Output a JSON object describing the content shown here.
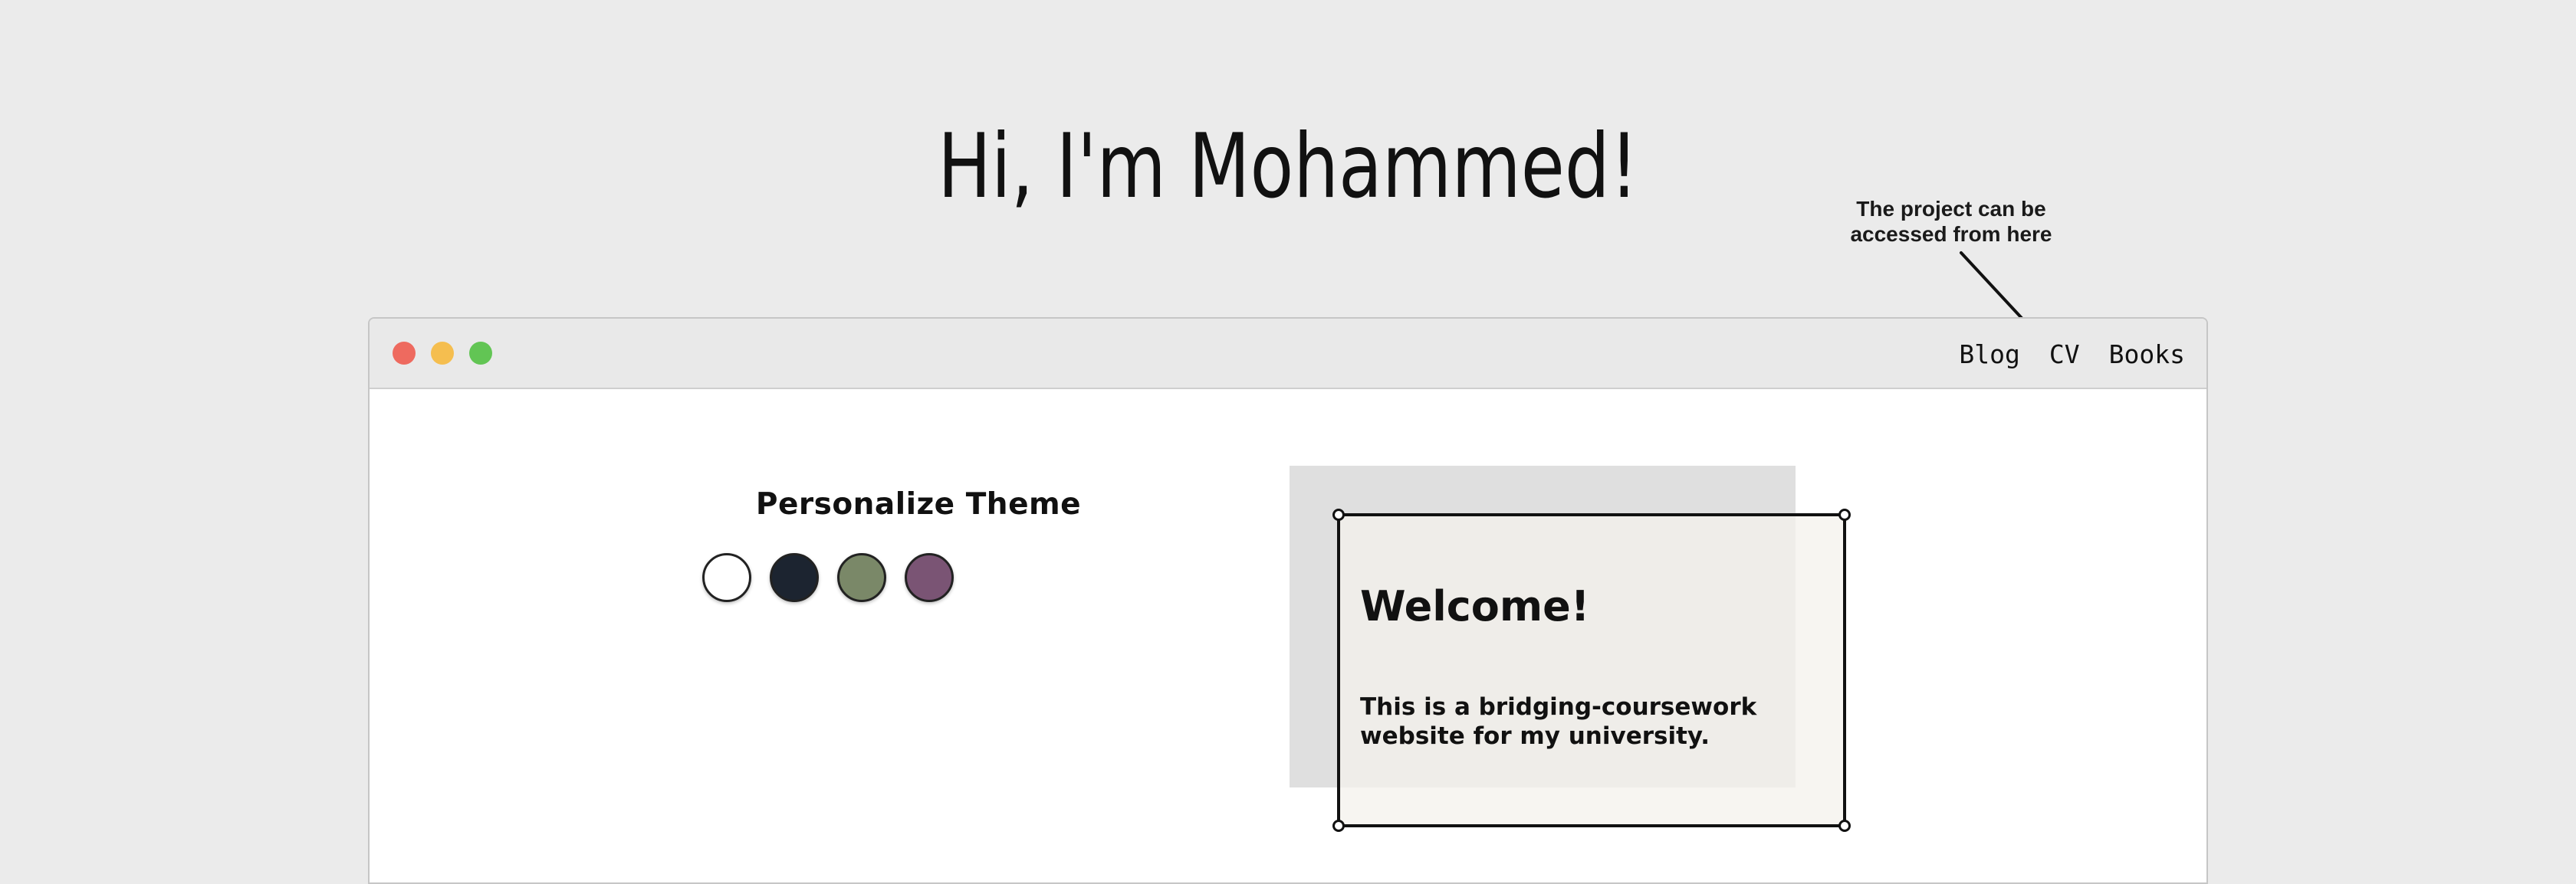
{
  "hero": {
    "title": "Hi, I'm Mohammed!"
  },
  "annotation": {
    "line1": "The project can be",
    "line2": "accessed from here",
    "arrow_icon": "arrow-pointer-icon"
  },
  "window": {
    "traffic_lights": [
      {
        "name": "close",
        "color": "#ee6a5f"
      },
      {
        "name": "minimize",
        "color": "#f5be4f"
      },
      {
        "name": "maximize",
        "color": "#62c554"
      }
    ],
    "nav": [
      {
        "label": "Blog"
      },
      {
        "label": "CV"
      },
      {
        "label": "Books"
      }
    ]
  },
  "theme": {
    "title": "Personalize Theme",
    "swatches": [
      {
        "name": "white",
        "color": "#ffffff"
      },
      {
        "name": "navy",
        "color": "#1c2430"
      },
      {
        "name": "olive",
        "color": "#7a8868"
      },
      {
        "name": "plum",
        "color": "#7a5474"
      }
    ]
  },
  "welcome_card": {
    "heading": "Welcome!",
    "line1": "This is a bridging-coursework",
    "line2": "website for my university."
  }
}
